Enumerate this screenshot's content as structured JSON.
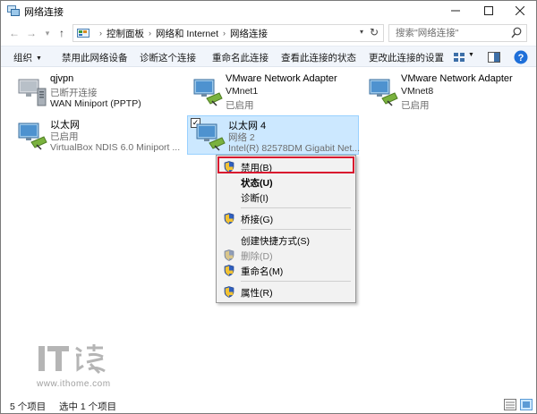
{
  "window": {
    "title": "网络连接",
    "controls": [
      "minimize",
      "maximize",
      "close"
    ]
  },
  "address": {
    "crumbs": [
      "控制面板",
      "网络和 Internet",
      "网络连接"
    ],
    "search_placeholder": "搜索\"网络连接\""
  },
  "commandbar": {
    "organize": "组织",
    "items": [
      "禁用此网络设备",
      "诊断这个连接",
      "重命名此连接",
      "查看此连接的状态",
      "更改此连接的设置"
    ]
  },
  "connections": [
    {
      "name": "qjvpn",
      "status": "已断开连接",
      "device": "WAN Miniport (PPTP)",
      "icon": "vpn-server-icon",
      "selected": false
    },
    {
      "name": "VMware Network Adapter",
      "status": "VMnet1",
      "device": "已启用",
      "icon": "network-adapter-icon",
      "selected": false
    },
    {
      "name": "VMware Network Adapter",
      "status": "VMnet8",
      "device": "已启用",
      "icon": "network-adapter-icon",
      "selected": false
    },
    {
      "name": "以太网",
      "status": "已启用",
      "device": "VirtualBox NDIS 6.0 Miniport ...",
      "icon": "network-adapter-icon",
      "selected": false
    },
    {
      "name": "以太网 4",
      "status": "网络  2",
      "device": "Intel(R) 82578DM Gigabit Net...",
      "icon": "network-adapter-icon",
      "selected": true
    }
  ],
  "context_menu": {
    "items": [
      {
        "label": "禁用(B)",
        "shield": true,
        "bold": false,
        "disabled": false,
        "highlighted": true
      },
      {
        "label": "状态(U)",
        "shield": false,
        "bold": true,
        "disabled": false,
        "highlighted": false
      },
      {
        "label": "诊断(I)",
        "shield": false,
        "bold": false,
        "disabled": false,
        "highlighted": false
      },
      {
        "label": "桥接(G)",
        "shield": true,
        "bold": false,
        "disabled": false,
        "highlighted": false
      },
      {
        "label": "创建快捷方式(S)",
        "shield": false,
        "bold": false,
        "disabled": false,
        "highlighted": false
      },
      {
        "label": "删除(D)",
        "shield": true,
        "bold": false,
        "disabled": true,
        "highlighted": false
      },
      {
        "label": "重命名(M)",
        "shield": true,
        "bold": false,
        "disabled": false,
        "highlighted": false
      },
      {
        "label": "属性(R)",
        "shield": true,
        "bold": false,
        "disabled": false,
        "highlighted": false
      }
    ]
  },
  "statusbar": {
    "count": "5 个项目",
    "selected": "选中 1 个项目"
  },
  "watermark": {
    "logo_text": "IT之家",
    "url": "www.ithome.com"
  },
  "colors": {
    "selection_fill": "#cce8ff",
    "selection_border": "#99d1ff",
    "highlight_border": "#d9142e",
    "commandbar_bg": "#f1f5fb",
    "help_blue": "#1e6fd9"
  }
}
